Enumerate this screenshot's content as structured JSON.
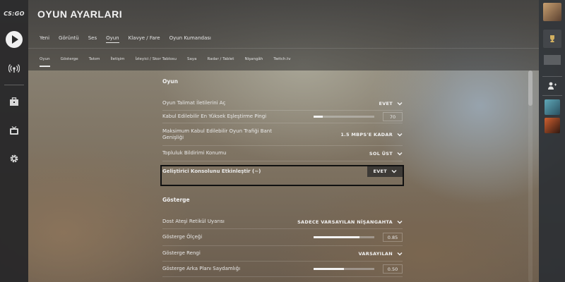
{
  "app": {
    "logo_text": "CS:GO"
  },
  "header": {
    "title": "OYUN AYARLARI"
  },
  "main_tabs": [
    {
      "label": "Yeni"
    },
    {
      "label": "Görüntü"
    },
    {
      "label": "Ses"
    },
    {
      "label": "Oyun",
      "active": true
    },
    {
      "label": "Klavye / Fare"
    },
    {
      "label": "Oyun Kumandası"
    }
  ],
  "sub_tabs": [
    {
      "label": "Oyun",
      "active": true
    },
    {
      "label": "Gösterge"
    },
    {
      "label": "Takım"
    },
    {
      "label": "İletişim"
    },
    {
      "label": "İzleyici / Skor Tablosu"
    },
    {
      "label": "Saya"
    },
    {
      "label": "Radar / Tablet"
    },
    {
      "label": "Nişangâh"
    },
    {
      "label": "Twitch.tv"
    }
  ],
  "icons": {
    "left": [
      "play-icon",
      "broadcast-icon",
      "briefcase-icon",
      "tv-icon",
      "gear-icon"
    ],
    "right": [
      "avatar",
      "trophy-icon",
      "friends-icon"
    ]
  },
  "sections": {
    "oyun": {
      "title": "Oyun",
      "rows": {
        "talimat": {
          "label": "Oyun Talimat İletilerini Aç",
          "value": "EVET"
        },
        "ping": {
          "label": "Kabul Edilebilir En Yüksek Eşleştirme Pingi",
          "value": "70",
          "fraction": 0.15
        },
        "bant": {
          "label": "Maksimum Kabul Edilebilir Oyun Trafiği Bant Genişliği",
          "value": "1.5 MBPS'E KADAR"
        },
        "bildirim": {
          "label": "Topluluk Bildirimi Konumu",
          "value": "SOL ÜST"
        },
        "konsol": {
          "label": "Geliştirici Konsolunu Etkinleştir (~)",
          "value": "EVET"
        }
      }
    },
    "gosterge": {
      "title": "Gösterge",
      "rows": {
        "retikul": {
          "label": "Dost Ateşi Retikül Uyarısı",
          "value": "SADECE VARSAYILAN NİŞANGAHTA"
        },
        "olcek": {
          "label": "Gösterge Ölçeği",
          "value": "0.85",
          "fraction": 0.75
        },
        "renk": {
          "label": "Gösterge Rengi",
          "value": "VARSAYILAN"
        },
        "saydamlik": {
          "label": "Gösterge Arka Planı Saydamlığı",
          "value": "0.50",
          "fraction": 0.5
        }
      }
    }
  },
  "colors": {
    "sidebar_bg": "#262628",
    "text": "#eaeaea",
    "highlight_border": "#111111"
  }
}
